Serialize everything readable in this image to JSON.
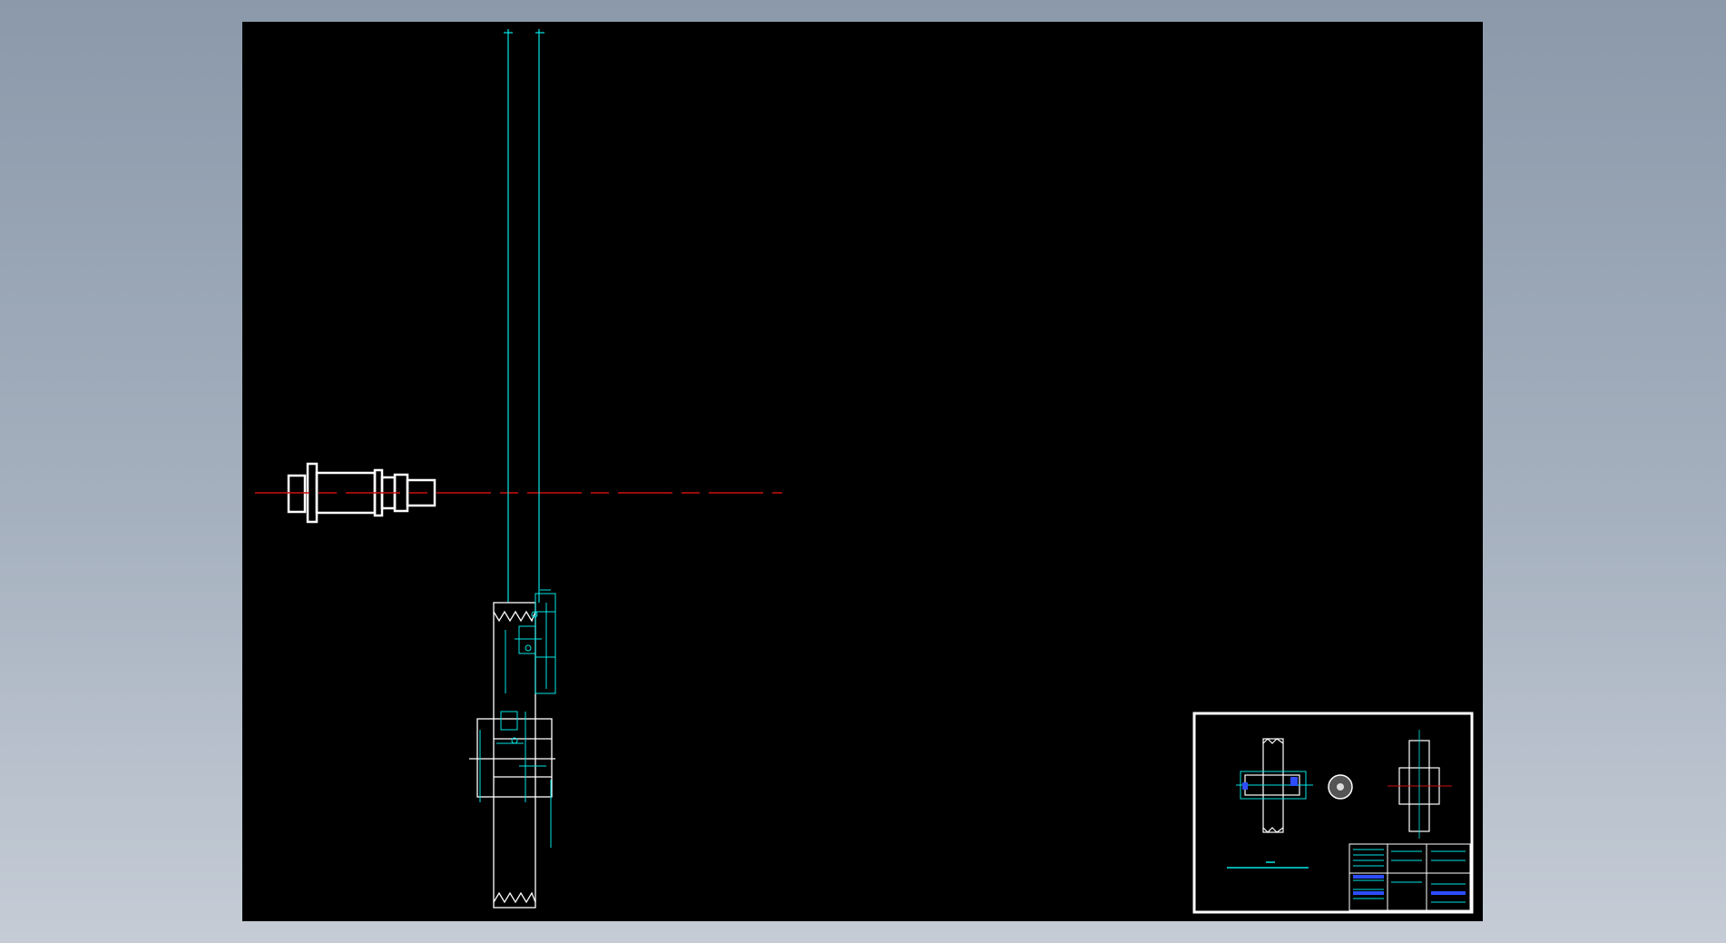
{
  "viewer": {
    "background_color": "#000000",
    "outer_gradient": [
      "#8b99aa",
      "#c5ccd6"
    ]
  },
  "drawing": {
    "line_colors": {
      "outline": "#ffffff",
      "dimension": "#00e5e5",
      "centerline": "#cc1111",
      "highlight": "#2d4dff"
    },
    "annotations": []
  },
  "thumbnail": {
    "title_block_present": true
  }
}
